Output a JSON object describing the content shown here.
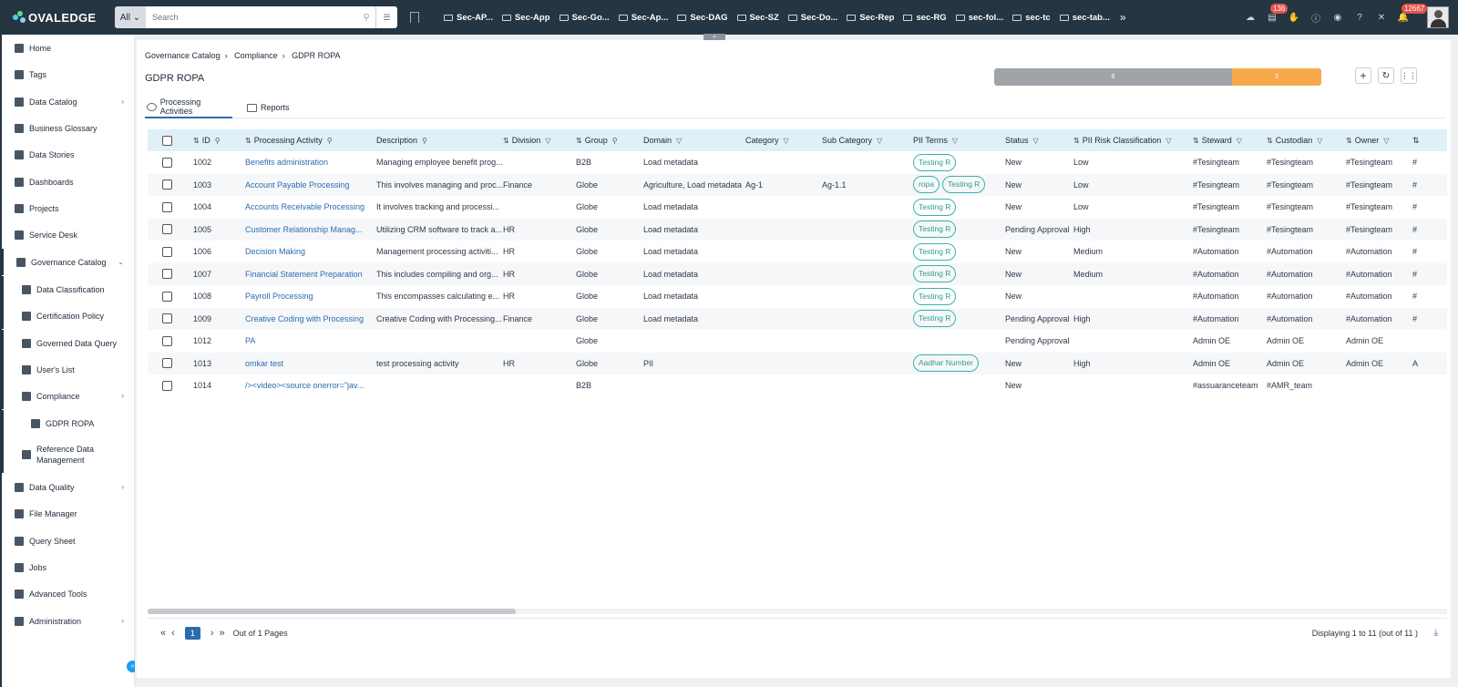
{
  "topbar": {
    "logo": "OVALEDGE",
    "search_scope": "All",
    "search_placeholder": "Search",
    "folders": [
      "Sec-AP...",
      "Sec-App",
      "Sec-Go...",
      "Sec-Ap...",
      "Sec-DAG",
      "Sec-SZ",
      "Sec-Do...",
      "Sec-Rep",
      "sec-RG",
      "sec-fol...",
      "sec-tc",
      "sec-tab..."
    ],
    "more": "»",
    "badge_tasks": "136",
    "badge_notifications": "12667"
  },
  "sidebar": {
    "items": [
      {
        "label": "Home"
      },
      {
        "label": "Tags"
      },
      {
        "label": "Data Catalog"
      },
      {
        "label": "Business Glossary"
      },
      {
        "label": "Data Stories"
      },
      {
        "label": "Dashboards"
      },
      {
        "label": "Projects"
      },
      {
        "label": "Service Desk"
      },
      {
        "label": "Governance Catalog"
      },
      {
        "label": "Data Classification"
      },
      {
        "label": "Certification Policy"
      },
      {
        "label": "Governed Data Query"
      },
      {
        "label": "User's List"
      },
      {
        "label": "Compliance"
      },
      {
        "label": "GDPR ROPA"
      },
      {
        "label": "Reference Data Management"
      },
      {
        "label": "Data Quality"
      },
      {
        "label": "File Manager"
      },
      {
        "label": "Query Sheet"
      },
      {
        "label": "Jobs"
      },
      {
        "label": "Advanced Tools"
      },
      {
        "label": "Administration"
      }
    ]
  },
  "breadcrumb": [
    "Governance Catalog",
    "Compliance",
    "GDPR ROPA"
  ],
  "page_title": "GDPR ROPA",
  "status_bar": {
    "grey_value": "8",
    "orange_value": "3"
  },
  "tabs": [
    "Processing Activities",
    "Reports"
  ],
  "table": {
    "columns": [
      "ID",
      "Processing Activity",
      "Description",
      "Division",
      "Group",
      "Domain",
      "Category",
      "Sub Category",
      "PII Terms",
      "Status",
      "PII Risk Classification",
      "Steward",
      "Custodian",
      "Owner"
    ],
    "rows": [
      {
        "id": "1002",
        "activity": "Benefits administration",
        "description": "Managing employee benefit prog...",
        "division": "",
        "group": "B2B",
        "domain": "Load metadata",
        "category": "",
        "subcategory": "",
        "pii": [
          "Testing R"
        ],
        "status": "New",
        "risk": "Low",
        "steward": "#Tesingteam",
        "custodian": "#Tesingteam",
        "owner": "#Tesingteam",
        "extra": "#"
      },
      {
        "id": "1003",
        "activity": "Account Payable Processing",
        "description": "This involves managing and proc...",
        "division": "Finance",
        "group": "Globe",
        "domain": "Agriculture, Load metadata",
        "category": "Ag-1",
        "subcategory": "Ag-1.1",
        "pii": [
          "ropa",
          "Testing R"
        ],
        "status": "New",
        "risk": "Low",
        "steward": "#Tesingteam",
        "custodian": "#Tesingteam",
        "owner": "#Tesingteam",
        "extra": "#"
      },
      {
        "id": "1004",
        "activity": "Accounts Receivable Processing",
        "description": "It involves tracking and processi...",
        "division": "",
        "group": "Globe",
        "domain": "Load metadata",
        "category": "",
        "subcategory": "",
        "pii": [
          "Testing R"
        ],
        "status": "New",
        "risk": "Low",
        "steward": "#Tesingteam",
        "custodian": "#Tesingteam",
        "owner": "#Tesingteam",
        "extra": "#"
      },
      {
        "id": "1005",
        "activity": "Customer Relationship Manag...",
        "description": "Utilizing CRM software to track a...",
        "division": "HR",
        "group": "Globe",
        "domain": "Load metadata",
        "category": "",
        "subcategory": "",
        "pii": [
          "Testing R"
        ],
        "status": "Pending Approval",
        "risk": "High",
        "steward": "#Tesingteam",
        "custodian": "#Tesingteam",
        "owner": "#Tesingteam",
        "extra": "#"
      },
      {
        "id": "1006",
        "activity": "Decision Making",
        "description": "Management processing activiti...",
        "division": "HR",
        "group": "Globe",
        "domain": "Load metadata",
        "category": "",
        "subcategory": "",
        "pii": [
          "Testing R"
        ],
        "status": "New",
        "risk": "Medium",
        "steward": "#Automation",
        "custodian": "#Automation",
        "owner": "#Automation",
        "extra": "#"
      },
      {
        "id": "1007",
        "activity": "Financial Statement Preparation",
        "description": "This includes compiling and org...",
        "division": "HR",
        "group": "Globe",
        "domain": "Load metadata",
        "category": "",
        "subcategory": "",
        "pii": [
          "Testing R"
        ],
        "status": "New",
        "risk": "Medium",
        "steward": "#Automation",
        "custodian": "#Automation",
        "owner": "#Automation",
        "extra": "#"
      },
      {
        "id": "1008",
        "activity": "Payroll Processing",
        "description": "This encompasses calculating e...",
        "division": "HR",
        "group": "Globe",
        "domain": "Load metadata",
        "category": "",
        "subcategory": "",
        "pii": [
          "Testing R"
        ],
        "status": "New",
        "risk": "",
        "steward": "#Automation",
        "custodian": "#Automation",
        "owner": "#Automation",
        "extra": "#"
      },
      {
        "id": "1009",
        "activity": "Creative Coding with Processing",
        "description": "Creative Coding with Processing...",
        "division": "Finance",
        "group": "Globe",
        "domain": "Load metadata",
        "category": "",
        "subcategory": "",
        "pii": [
          "Testing R"
        ],
        "status": "Pending Approval",
        "risk": "High",
        "steward": "#Automation",
        "custodian": "#Automation",
        "owner": "#Automation",
        "extra": "#"
      },
      {
        "id": "1012",
        "activity": "PA",
        "description": "",
        "division": "",
        "group": "Globe",
        "domain": "",
        "category": "",
        "subcategory": "",
        "pii": [],
        "status": "Pending Approval",
        "risk": "",
        "steward": "Admin OE",
        "custodian": "Admin OE",
        "owner": "Admin OE",
        "extra": ""
      },
      {
        "id": "1013",
        "activity": "omkar test",
        "description": "test processing activity",
        "division": "HR",
        "group": "Globe",
        "domain": "PII",
        "category": "",
        "subcategory": "",
        "pii": [
          "Aadhar Number"
        ],
        "status": "New",
        "risk": "High",
        "steward": "Admin OE",
        "custodian": "Admin OE",
        "owner": "Admin OE",
        "extra": "A"
      },
      {
        "id": "1014",
        "activity": "/><video><source onerror=\"jav...",
        "description": "",
        "division": "",
        "group": "B2B",
        "domain": "",
        "category": "",
        "subcategory": "",
        "pii": [],
        "status": "New",
        "risk": "",
        "steward": "#assuaranceteam",
        "custodian": "#AMR_team",
        "owner": "",
        "extra": ""
      }
    ]
  },
  "pagination": {
    "current": "1",
    "info": "Out of 1 Pages",
    "display": "Displaying 1 to 11  (out of 11 )"
  }
}
